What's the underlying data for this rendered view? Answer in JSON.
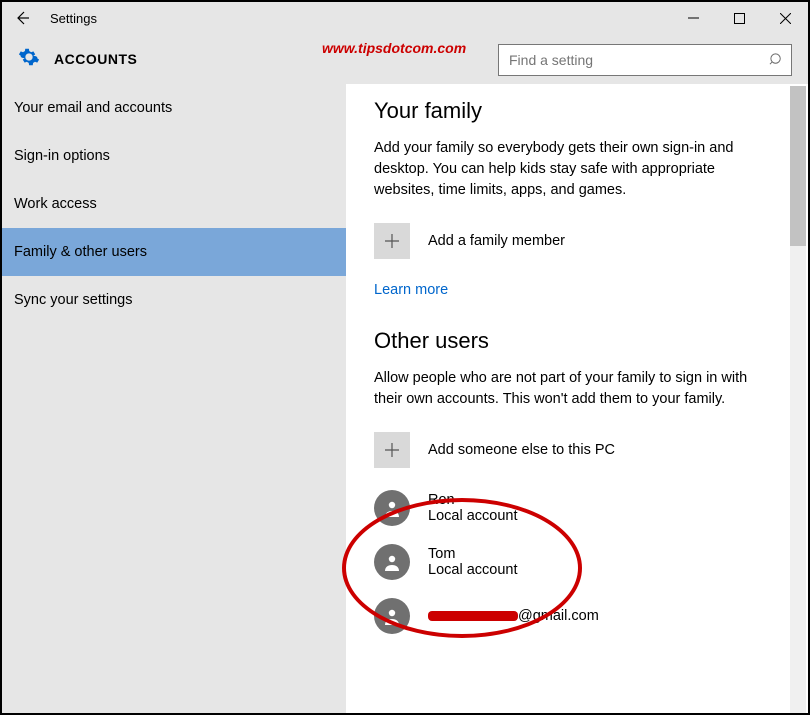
{
  "titlebar": {
    "title": "Settings"
  },
  "header": {
    "section": "ACCOUNTS",
    "watermark": "www.tipsdotcom.com"
  },
  "search": {
    "placeholder": "Find a setting"
  },
  "sidebar": {
    "items": [
      {
        "label": "Your email and accounts"
      },
      {
        "label": "Sign-in options"
      },
      {
        "label": "Work access"
      },
      {
        "label": "Family & other users"
      },
      {
        "label": "Sync your settings"
      }
    ]
  },
  "family": {
    "heading": "Your family",
    "desc": "Add your family so everybody gets their own sign-in and desktop. You can help kids stay safe with appropriate websites, time limits, apps, and games.",
    "add_label": "Add a family member",
    "learn_more": "Learn more"
  },
  "other": {
    "heading": "Other users",
    "desc": "Allow people who are not part of your family to sign in with their own accounts. This won't add them to your family.",
    "add_label": "Add someone else to this PC",
    "users": [
      {
        "name": "Ron",
        "type": "Local account"
      },
      {
        "name": "Tom",
        "type": "Local account"
      },
      {
        "name_suffix": "@gmail.com",
        "type": ""
      }
    ]
  }
}
